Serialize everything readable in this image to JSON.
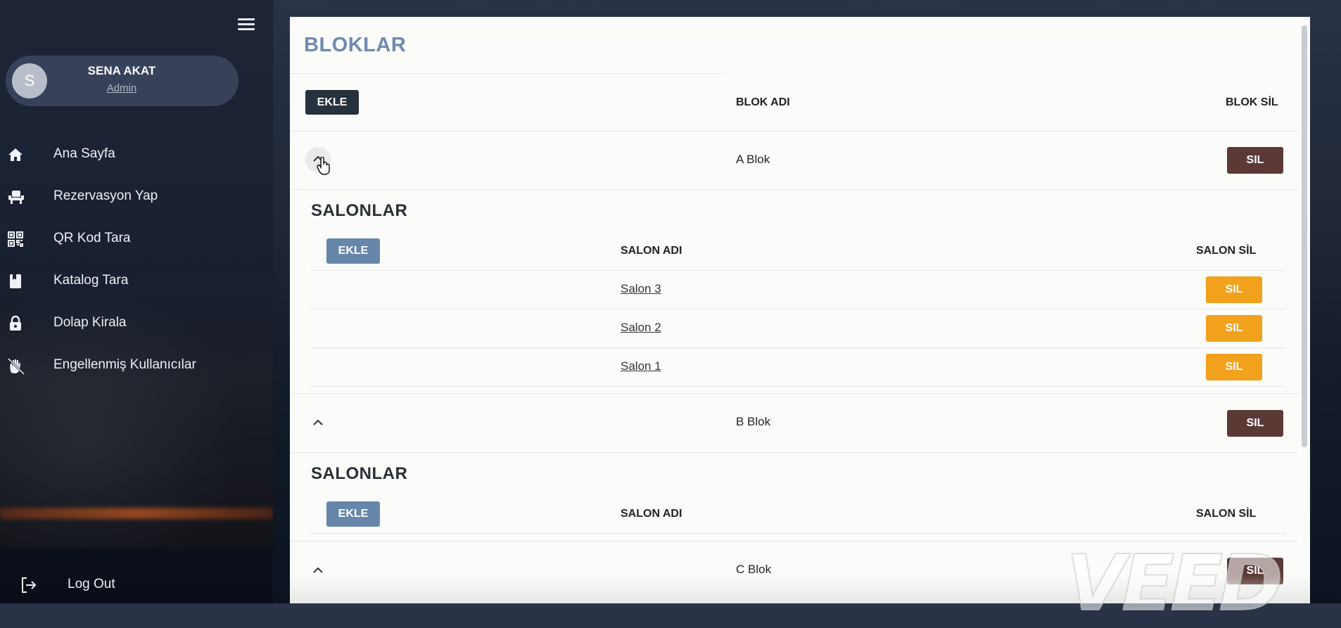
{
  "sidebar": {
    "user": {
      "avatar_letter": "S",
      "name": "SENA AKAT",
      "role": "Admin"
    },
    "items": [
      {
        "label": "Ana Sayfa",
        "icon": "home-icon"
      },
      {
        "label": "Rezervasyon Yap",
        "icon": "seat-icon"
      },
      {
        "label": "QR Kod Tara",
        "icon": "qr-code-icon"
      },
      {
        "label": "Katalog Tara",
        "icon": "book-icon"
      },
      {
        "label": "Dolap Kirala",
        "icon": "lock-icon"
      },
      {
        "label": "Engellenmiş Kullanıcılar",
        "icon": "blocked-hand-icon"
      }
    ],
    "logout": {
      "label": "Log Out",
      "icon": "logout-icon"
    }
  },
  "main": {
    "title": "BLOKLAR",
    "add_label": "EKLE",
    "col_block_name": "BLOK ADI",
    "col_block_delete": "BLOK SİL",
    "delete_label": "SIL",
    "blocks": [
      {
        "name": "A Blok",
        "expanded": true,
        "salons_title": "SALONLAR",
        "salon_add_label": "EKLE",
        "col_salon_name": "SALON ADI",
        "col_salon_delete": "SALON SİL",
        "salons": [
          {
            "name": "Salon 3",
            "delete_label": "SIL"
          },
          {
            "name": "Salon 2",
            "delete_label": "SIL"
          },
          {
            "name": "Salon 1",
            "delete_label": "SIL"
          }
        ]
      },
      {
        "name": "B Blok",
        "expanded": true,
        "salons_title": "SALONLAR",
        "salon_add_label": "EKLE",
        "col_salon_name": "SALON ADI",
        "col_salon_delete": "SALON SİL",
        "salons": []
      },
      {
        "name": "C Blok",
        "expanded": false
      }
    ]
  },
  "watermark": "VEED",
  "colors": {
    "title": "#6f8ab0",
    "dark_button": "#25313d",
    "blue_button": "#6686aa",
    "block_delete": "#5b3a36",
    "salon_delete": "#f2a11c"
  }
}
